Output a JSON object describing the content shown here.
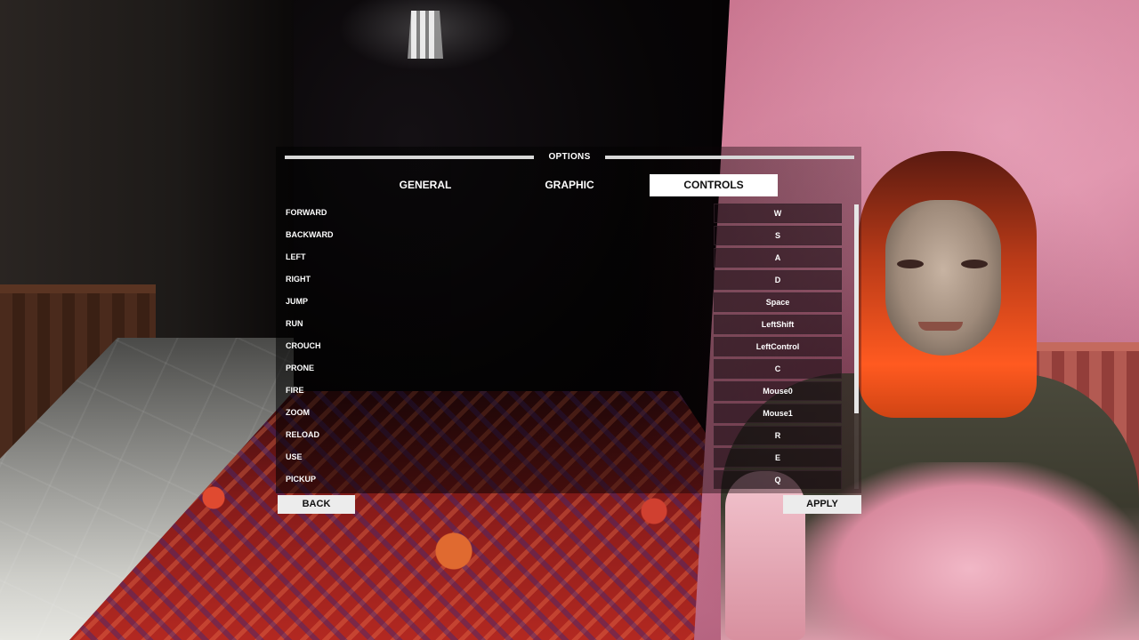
{
  "options": {
    "title": "OPTIONS",
    "tabs": [
      {
        "label": "GENERAL",
        "active": false
      },
      {
        "label": "GRAPHIC",
        "active": false
      },
      {
        "label": "CONTROLS",
        "active": true
      }
    ],
    "bindings": [
      {
        "action": "FORWARD",
        "key": "W"
      },
      {
        "action": "BACKWARD",
        "key": "S"
      },
      {
        "action": "LEFT",
        "key": "A"
      },
      {
        "action": "RIGHT",
        "key": "D"
      },
      {
        "action": "JUMP",
        "key": "Space"
      },
      {
        "action": "RUN",
        "key": "LeftShift"
      },
      {
        "action": "CROUCH",
        "key": "LeftControl"
      },
      {
        "action": "PRONE",
        "key": "C"
      },
      {
        "action": "FIRE",
        "key": "Mouse0"
      },
      {
        "action": "ZOOM",
        "key": "Mouse1"
      },
      {
        "action": "RELOAD",
        "key": "R"
      },
      {
        "action": "USE",
        "key": "E"
      },
      {
        "action": "PICKUP",
        "key": "Q"
      }
    ],
    "back_label": "BACK",
    "apply_label": "APPLY"
  },
  "colors": {
    "tab_active_bg": "#ffffff",
    "button_bg": "#ececec",
    "text": "#ffffff"
  }
}
